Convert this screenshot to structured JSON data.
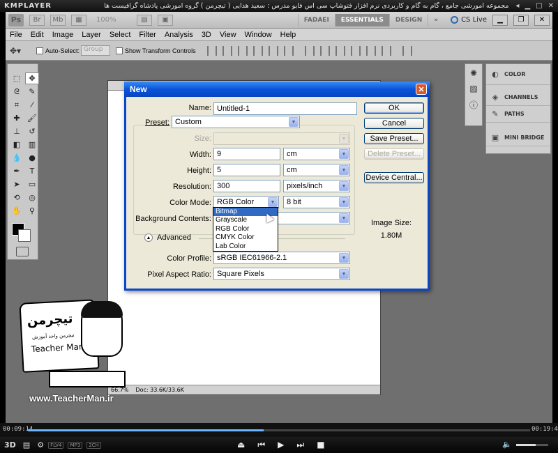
{
  "player": {
    "logo": "KMPLAYER",
    "title": "مجموعه آموزشی جامع ، گام به گام و کاربردی نرم افزار فتوشاپ سی اس فایو  مدرس : سعید هدایی ( تیچرمن ) گروه آموزشی پادشاه گرافیست ها",
    "time_elapsed": "00:09:14",
    "time_total": "00:19:42",
    "progress": 0.469,
    "volume": 0.6,
    "badges": [
      "FLV4",
      "MP3",
      "2CH"
    ],
    "control_3d": "3D"
  },
  "appbar": {
    "zoom": "100%",
    "workspaces": [
      "FADAEI",
      "ESSENTIALS",
      "DESIGN"
    ],
    "active_workspace": "ESSENTIALS",
    "cslive": "CS Live"
  },
  "menu": [
    "File",
    "Edit",
    "Image",
    "Layer",
    "Select",
    "Filter",
    "Analysis",
    "3D",
    "View",
    "Window",
    "Help"
  ],
  "options": {
    "auto_select_label": "Auto-Select:",
    "auto_select_value": "Group",
    "show_transform_label": "Show Transform Controls"
  },
  "panels": {
    "group1": [
      "COLOR"
    ],
    "group2": [
      "CHANNELS",
      "PATHS"
    ],
    "group3": [
      "MINI BRIDGE"
    ]
  },
  "document": {
    "zoom": "66.7%",
    "doc_info": "Doc: 33.6K/33.6K"
  },
  "dialog": {
    "title": "New",
    "name_label": "Name:",
    "name_value": "Untitled-1",
    "preset_label": "Preset:",
    "preset_value": "Custom",
    "size_label": "Size:",
    "width_label": "Width:",
    "width_value": "9",
    "width_unit": "cm",
    "height_label": "Height:",
    "height_value": "5",
    "height_unit": "cm",
    "resolution_label": "Resolution:",
    "resolution_value": "300",
    "resolution_unit": "pixels/inch",
    "color_mode_label": "Color Mode:",
    "color_mode_value": "RGB Color",
    "bit_depth": "8 bit",
    "bg_contents_label": "Background Contents:",
    "advanced_label": "Advanced",
    "color_profile_label": "Color Profile:",
    "color_profile_value": "sRGB IEC61966-2.1",
    "pixel_aspect_label": "Pixel Aspect Ratio:",
    "pixel_aspect_value": "Square Pixels",
    "image_size_label": "Image Size:",
    "image_size_value": "1.80M",
    "buttons": {
      "ok": "OK",
      "cancel": "Cancel",
      "save_preset": "Save Preset...",
      "delete_preset": "Delete Preset...",
      "device_central": "Device Central..."
    },
    "color_mode_options": [
      "Bitmap",
      "Grayscale",
      "RGB Color",
      "CMYK Color",
      "Lab Color"
    ],
    "highlighted_option": "Bitmap"
  },
  "watermark": {
    "logo_text": "تیچرمن",
    "sub_text": "تیچرمن واحد آموزش",
    "name": "Teacher Man",
    "url": "www.TeacherMan.ir"
  },
  "colors": {
    "xp_title": "#0a54d8",
    "highlight": "#316ac5",
    "ps_background": "#6f6f6f"
  }
}
